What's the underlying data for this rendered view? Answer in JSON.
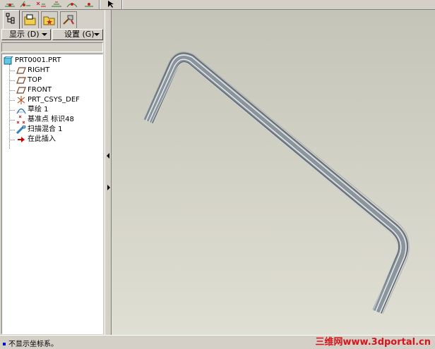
{
  "toolbar": {
    "buttons": [
      "datum-plane-icon",
      "datum-axis-icon",
      "datum-csys-icon",
      "datum-point-icon",
      "datum-curve-icon",
      "select-arrow-icon"
    ]
  },
  "panel": {
    "tabs": [
      "model-tree-icon",
      "folder-browser-icon",
      "favorites-icon",
      "connections-icon"
    ],
    "display_menu": "显示 (D)",
    "settings_menu": "设置 (G)"
  },
  "model_tree": {
    "items": [
      {
        "label": "PRT0001.PRT",
        "icon": "part-icon"
      },
      {
        "label": "RIGHT",
        "icon": "datum-plane-icon"
      },
      {
        "label": "TOP",
        "icon": "datum-plane-icon"
      },
      {
        "label": "FRONT",
        "icon": "datum-plane-icon"
      },
      {
        "label": "PRT_CSYS_DEF",
        "icon": "coordinate-system-icon"
      },
      {
        "label": "草绘 1",
        "icon": "sketch-icon"
      },
      {
        "label": "基准点 标识48",
        "icon": "datum-point-icon"
      },
      {
        "label": "扫描混合 1",
        "icon": "swept-blend-icon"
      },
      {
        "label": "在此插入",
        "icon": "insert-here-arrow-icon"
      }
    ]
  },
  "status": {
    "message": "不显示坐标系。"
  },
  "watermark": "三维网www.3dportal.cn",
  "colors": {
    "window_bg": "#d4d0c8",
    "viewport_bg": "#d0cfc4",
    "model_color": "#9aa3ab",
    "watermark": "#d8141a",
    "insert_arrow": "#cc0000"
  }
}
